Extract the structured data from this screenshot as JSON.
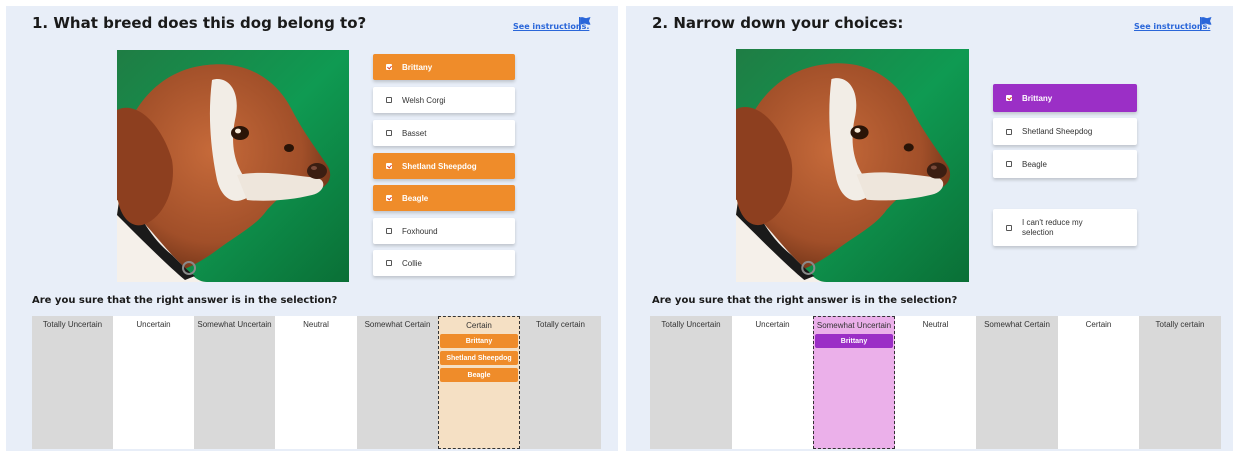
{
  "colors": {
    "accent_orange": "#ef8c2a",
    "accent_purple": "#9b2fc6",
    "link_blue": "#2a66d9",
    "panel_bg": "#e8eef8",
    "highlight_orange": "#f5e0c4",
    "highlight_purple": "#ebb0ea"
  },
  "left": {
    "title": "1. What breed does this dog belong to?",
    "instructions_link": "See instructions.",
    "choices": [
      {
        "label": "Brittany",
        "selected": true
      },
      {
        "label": "Welsh Corgi",
        "selected": false
      },
      {
        "label": "Basset",
        "selected": false
      },
      {
        "label": "Shetland Sheepdog",
        "selected": true
      },
      {
        "label": "Beagle",
        "selected": true
      },
      {
        "label": "Foxhound",
        "selected": false
      },
      {
        "label": "Collie",
        "selected": false
      }
    ],
    "question": "Are you sure that the right answer is in the selection?",
    "scale": [
      {
        "label": "Totally Uncertain",
        "chips": []
      },
      {
        "label": "Uncertain",
        "chips": []
      },
      {
        "label": "Somewhat Uncertain",
        "chips": []
      },
      {
        "label": "Neutral",
        "chips": []
      },
      {
        "label": "Somewhat Certain",
        "chips": []
      },
      {
        "label": "Certain",
        "chips": [
          "Brittany",
          "Shetland Sheepdog",
          "Beagle"
        ]
      },
      {
        "label": "Totally certain",
        "chips": []
      }
    ]
  },
  "right": {
    "title": "2. Narrow down your choices:",
    "instructions_link": "See instructions.",
    "choices": [
      {
        "label": "Brittany",
        "selected": true
      },
      {
        "label": "Shetland Sheepdog",
        "selected": false
      },
      {
        "label": "Beagle",
        "selected": false
      }
    ],
    "cant_reduce": {
      "line1": "I can't reduce my",
      "line2": "selection"
    },
    "question": "Are you sure that the right answer is in the selection?",
    "scale": [
      {
        "label": "Totally Uncertain",
        "chips": []
      },
      {
        "label": "Uncertain",
        "chips": []
      },
      {
        "label": "Somewhat Uncertain",
        "chips": [
          "Brittany"
        ]
      },
      {
        "label": "Neutral",
        "chips": []
      },
      {
        "label": "Somewhat Certain",
        "chips": []
      },
      {
        "label": "Certain",
        "chips": []
      },
      {
        "label": "Totally certain",
        "chips": []
      }
    ]
  }
}
